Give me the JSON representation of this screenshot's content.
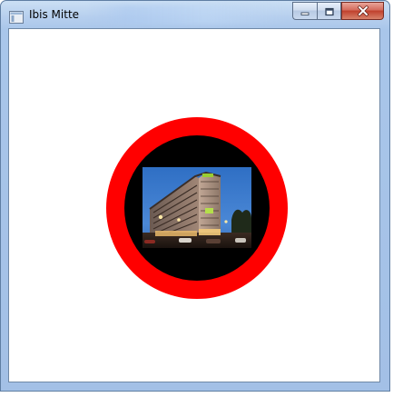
{
  "window": {
    "title": "Ibis Mitte",
    "icon": "app-window-icon",
    "buttons": {
      "minimize": "minimize-icon",
      "maximize": "restore-icon",
      "close": "close-icon"
    }
  },
  "content": {
    "ring": {
      "outer_color": "#ff0000",
      "inner_color": "#000000"
    },
    "photo": {
      "subject": "hotel-building-photo"
    }
  }
}
